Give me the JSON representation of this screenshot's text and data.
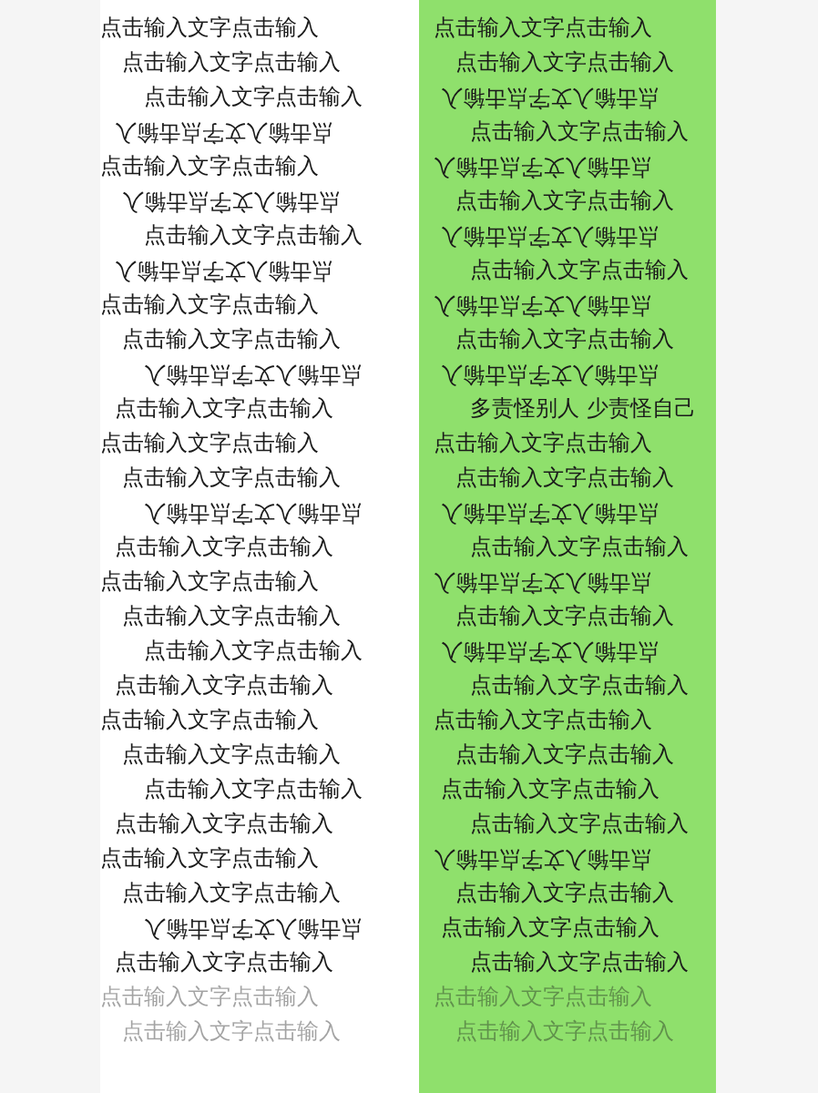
{
  "left_messages": [
    {
      "text": "点击输入文字点击输入",
      "kind": "normal"
    },
    {
      "text": "点击输入文字点击输入",
      "kind": "normal"
    },
    {
      "text": "点击输入文字点击输入",
      "kind": "normal"
    },
    {
      "text": "点击输入文字点击输入",
      "kind": "flipped"
    },
    {
      "text": "点击输入文字点击输入",
      "kind": "normal"
    },
    {
      "text": "点击输入文字点击输入",
      "kind": "flipped"
    },
    {
      "text": "点击输入文字点击输入",
      "kind": "normal"
    },
    {
      "text": "点击输入文字点击输入",
      "kind": "flipped"
    },
    {
      "text": "点击输入文字点击输入",
      "kind": "normal"
    },
    {
      "text": "点击输入文字点击输入",
      "kind": "normal"
    },
    {
      "text": "点击输入文字点击输入",
      "kind": "flipped"
    },
    {
      "text": "点击输入文字点击输入",
      "kind": "normal"
    },
    {
      "text": "点击输入文字点击输入",
      "kind": "normal"
    },
    {
      "text": "点击输入文字点击输入",
      "kind": "normal"
    },
    {
      "text": "点击输入文字点击输入",
      "kind": "flipped"
    },
    {
      "text": "点击输入文字点击输入",
      "kind": "normal"
    },
    {
      "text": "点击输入文字点击输入",
      "kind": "normal"
    },
    {
      "text": "点击输入文字点击输入",
      "kind": "normal"
    },
    {
      "text": "点击输入文字点击输入",
      "kind": "normal"
    },
    {
      "text": "点击输入文字点击输入",
      "kind": "normal"
    },
    {
      "text": "点击输入文字点击输入",
      "kind": "normal"
    },
    {
      "text": "点击输入文字点击输入",
      "kind": "normal"
    },
    {
      "text": "点击输入文字点击输入",
      "kind": "normal"
    },
    {
      "text": "点击输入文字点击输入",
      "kind": "normal"
    },
    {
      "text": "点击输入文字点击输入",
      "kind": "normal"
    },
    {
      "text": "点击输入文字点击输入",
      "kind": "normal"
    },
    {
      "text": "点击输入文字点击输入",
      "kind": "flipped"
    },
    {
      "text": "点击输入文字点击输入",
      "kind": "normal"
    },
    {
      "text": "点击输入文字点击输入",
      "kind": "faded"
    },
    {
      "text": "点击输入文字点击输入",
      "kind": "faded"
    }
  ],
  "right_messages": [
    {
      "text": "点击输入文字点击输入",
      "kind": "normal"
    },
    {
      "text": "点击输入文字点击输入",
      "kind": "normal"
    },
    {
      "text": "点击输入文字点击输入",
      "kind": "flipped"
    },
    {
      "text": "点击输入文字点击输入",
      "kind": "normal"
    },
    {
      "text": "点击输入文字点击输入",
      "kind": "flipped"
    },
    {
      "text": "点击输入文字点击输入",
      "kind": "normal"
    },
    {
      "text": "点击输入文字点击输入",
      "kind": "flipped"
    },
    {
      "text": "点击输入文字点击输入",
      "kind": "normal"
    },
    {
      "text": "点击输入文字点击输入",
      "kind": "flipped"
    },
    {
      "text": "点击输入文字点击输入",
      "kind": "normal"
    },
    {
      "text": "点击输入文字点击输入",
      "kind": "flipped"
    },
    {
      "text": "多责怪别人 少责怪自己",
      "kind": "normal"
    },
    {
      "text": "点击输入文字点击输入",
      "kind": "normal"
    },
    {
      "text": "点击输入文字点击输入",
      "kind": "normal"
    },
    {
      "text": "点击输入文字点击输入",
      "kind": "flipped"
    },
    {
      "text": "点击输入文字点击输入",
      "kind": "normal"
    },
    {
      "text": "点击输入文字点击输入",
      "kind": "flipped"
    },
    {
      "text": "点击输入文字点击输入",
      "kind": "normal"
    },
    {
      "text": "点击输入文字点击输入",
      "kind": "flipped"
    },
    {
      "text": "点击输入文字点击输入",
      "kind": "normal"
    },
    {
      "text": "点击输入文字点击输入",
      "kind": "normal"
    },
    {
      "text": "点击输入文字点击输入",
      "kind": "normal"
    },
    {
      "text": "点击输入文字点击输入",
      "kind": "normal"
    },
    {
      "text": "点击输入文字点击输入",
      "kind": "normal"
    },
    {
      "text": "点击输入文字点击输入",
      "kind": "flipped"
    },
    {
      "text": "点击输入文字点击输入",
      "kind": "normal"
    },
    {
      "text": "点击输入文字点击输入",
      "kind": "normal"
    },
    {
      "text": "点击输入文字点击输入",
      "kind": "normal"
    },
    {
      "text": "点击输入文字点击输入",
      "kind": "faded"
    },
    {
      "text": "点击输入文字点击输入",
      "kind": "faded"
    }
  ]
}
